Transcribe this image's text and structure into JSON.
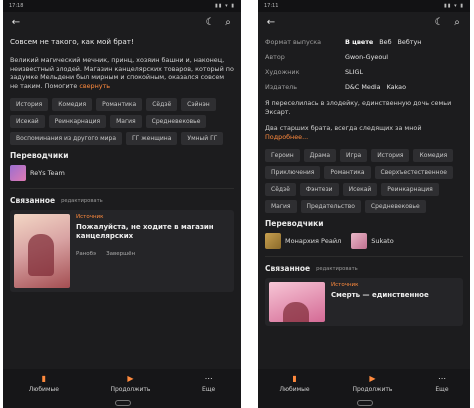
{
  "left": {
    "status": {
      "time": "17:18",
      "icons": "▮▮ ▾ ▮"
    },
    "title_line": "Совсем не такого, как мой брат!",
    "description": "Великий магический мечник, принц, хозяин башни и, наконец, неизвестный злодей. Магазин канцелярских товаров, который по задумке Мельдени был мирным и спокойным, оказался совсем не таким. Помогите",
    "more_label": "свернуть",
    "tags": [
      "История",
      "Комедия",
      "Романтика",
      "Сёдзё",
      "Сэйнэн",
      "Исекай",
      "Реинкарнация",
      "Магия",
      "Средневековье",
      "Воспоминания из другого мира",
      "ГГ женщина",
      "Умный ГГ"
    ],
    "translators_title": "Переводчики",
    "translators": [
      {
        "name": "ReYs Team"
      }
    ],
    "related": {
      "title": "Связанное",
      "subtitle": "редактировать",
      "card": {
        "tag": "Источник",
        "title": "Пожалуйста, не ходите в магазин канцелярских",
        "status": "Ранобэ",
        "state": "Завершён"
      }
    },
    "nav": [
      {
        "icon": "bookmark-icon",
        "label": "Любимые"
      },
      {
        "icon": "play-icon",
        "label": "Продолжить"
      },
      {
        "icon": "more-icon",
        "label": "Еще"
      }
    ]
  },
  "right": {
    "status": {
      "time": "17:11",
      "icons": "▮▮ ▾ ▮"
    },
    "info": [
      {
        "key": "Формат выпуска",
        "values": [
          "В цвете",
          "Веб",
          "Вебтун"
        ]
      },
      {
        "key": "Автор",
        "values": [
          "Gwon-Gyeoul"
        ]
      },
      {
        "key": "Художник",
        "values": [
          "SLIGL"
        ]
      },
      {
        "key": "Издатель",
        "values": [
          "D&C Media",
          "Kakao"
        ]
      }
    ],
    "intro": "Я переселилась в злодейку, единственную дочь семьи Эксарт.",
    "summary": "Два старших брата, всегда следящих за мной",
    "more_label": "Подробнее...",
    "tags": [
      "Героин",
      "Драма",
      "Игра",
      "История",
      "Комедия",
      "Приключения",
      "Романтика",
      "Сверхъестественное",
      "Сёдзё",
      "Фэнтези",
      "Исекай",
      "Реинкарнация",
      "Магия",
      "Предательство",
      "Средневековье"
    ],
    "translators_title": "Переводчики",
    "translators": [
      {
        "name": "Монархия Ре­айл"
      },
      {
        "name": "Sukato"
      }
    ],
    "related": {
      "title": "Связанное",
      "subtitle": "редактировать",
      "card": {
        "tag": "Источник",
        "title": "Смерть — единственное"
      }
    },
    "nav": [
      {
        "icon": "bookmark-icon",
        "label": "Любимые"
      },
      {
        "icon": "play-icon",
        "label": "Продолжить"
      },
      {
        "icon": "more-icon",
        "label": "Еще"
      }
    ]
  },
  "colors": {
    "accent": "#ff8a3d",
    "bg": "#1c1c1e",
    "chip": "#2e2e31"
  }
}
